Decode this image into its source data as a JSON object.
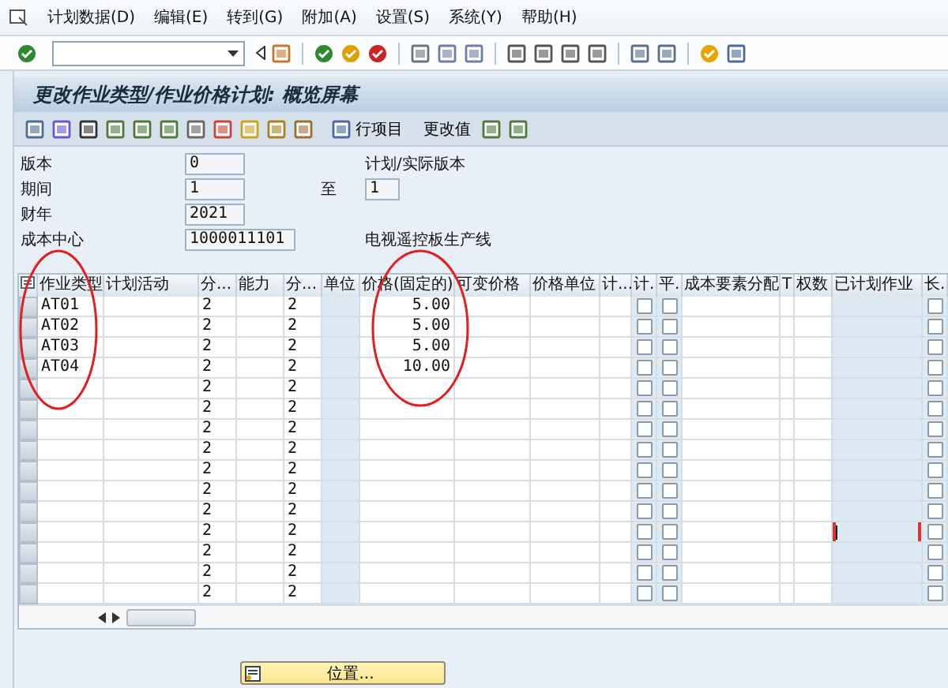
{
  "menu": [
    "计划数据(D)",
    "编辑(E)",
    "转到(G)",
    "附加(A)",
    "设置(S)",
    "系统(Y)",
    "帮助(H)"
  ],
  "window": {
    "title": "更改作业类型/作业价格计划: 概览屏幕"
  },
  "app_toolbar": {
    "line_items": "行项目",
    "change_values": "更改值"
  },
  "form": {
    "version_label": "版本",
    "version": "0",
    "version_text": "计划/实际版本",
    "period_label": "期间",
    "period_from": "1",
    "to_label": "至",
    "period_to": "1",
    "year_label": "财年",
    "year": "2021",
    "cost_center_label": "成本中心",
    "cost_center": "1000011101",
    "cost_center_text": "电视遥控板生产线"
  },
  "table": {
    "columns": [
      {
        "kind": "marker",
        "readonly": false
      },
      {
        "kind": "text",
        "label": "作业类型",
        "readonly": false
      },
      {
        "kind": "text",
        "label": "计划活动",
        "readonly": false
      },
      {
        "kind": "text",
        "label": "分...",
        "readonly": false
      },
      {
        "kind": "text",
        "label": "能力",
        "readonly": false
      },
      {
        "kind": "text",
        "label": "分...",
        "readonly": false
      },
      {
        "kind": "text",
        "label": "单位",
        "readonly": true
      },
      {
        "kind": "number",
        "label": "价格(固定的)",
        "readonly": false
      },
      {
        "kind": "text",
        "label": "可变价格",
        "readonly": false
      },
      {
        "kind": "text",
        "label": "价格单位",
        "readonly": false
      },
      {
        "kind": "text",
        "label": "计...",
        "readonly": false
      },
      {
        "kind": "check",
        "label": "计.",
        "readonly": true
      },
      {
        "kind": "check",
        "label": "平.",
        "readonly": true
      },
      {
        "kind": "text",
        "label": "成本要素分配",
        "readonly": false
      },
      {
        "kind": "text",
        "label": "T",
        "readonly": false
      },
      {
        "kind": "text",
        "label": "权数",
        "readonly": false
      },
      {
        "kind": "text",
        "label": "已计划作业",
        "readonly": true
      },
      {
        "kind": "check",
        "label": "长.",
        "readonly": true
      }
    ],
    "rows": [
      {
        "activity_type": "AT01",
        "dist_1": "2",
        "dist_2": "2",
        "price_fixed": "5.00",
        "plan_checked": false,
        "avg_checked": false,
        "long_checked": false,
        "focused": false
      },
      {
        "activity_type": "AT02",
        "dist_1": "2",
        "dist_2": "2",
        "price_fixed": "5.00",
        "plan_checked": false,
        "avg_checked": false,
        "long_checked": false,
        "focused": false
      },
      {
        "activity_type": "AT03",
        "dist_1": "2",
        "dist_2": "2",
        "price_fixed": "5.00",
        "plan_checked": false,
        "avg_checked": false,
        "long_checked": false,
        "focused": false
      },
      {
        "activity_type": "AT04",
        "dist_1": "2",
        "dist_2": "2",
        "price_fixed": "10.00",
        "plan_checked": false,
        "avg_checked": false,
        "long_checked": false,
        "focused": false
      },
      {
        "dist_1": "2",
        "dist_2": "2",
        "plan_checked": false,
        "avg_checked": false,
        "long_checked": false,
        "focused": false
      },
      {
        "dist_1": "2",
        "dist_2": "2",
        "plan_checked": false,
        "avg_checked": false,
        "long_checked": false,
        "focused": false
      },
      {
        "dist_1": "2",
        "dist_2": "2",
        "plan_checked": false,
        "avg_checked": false,
        "long_checked": false,
        "focused": false
      },
      {
        "dist_1": "2",
        "dist_2": "2",
        "plan_checked": false,
        "avg_checked": false,
        "long_checked": false,
        "focused": false
      },
      {
        "dist_1": "2",
        "dist_2": "2",
        "plan_checked": false,
        "avg_checked": false,
        "long_checked": false,
        "focused": false
      },
      {
        "dist_1": "2",
        "dist_2": "2",
        "plan_checked": false,
        "avg_checked": false,
        "long_checked": false,
        "focused": false
      },
      {
        "dist_1": "2",
        "dist_2": "2",
        "plan_checked": false,
        "avg_checked": false,
        "long_checked": false,
        "focused": false
      },
      {
        "dist_1": "2",
        "dist_2": "2",
        "plan_checked": false,
        "avg_checked": false,
        "long_checked": false,
        "focused": true
      },
      {
        "dist_1": "2",
        "dist_2": "2",
        "plan_checked": false,
        "avg_checked": false,
        "long_checked": false,
        "focused": false
      },
      {
        "dist_1": "2",
        "dist_2": "2",
        "plan_checked": false,
        "avg_checked": false,
        "long_checked": false,
        "focused": false
      },
      {
        "dist_1": "2",
        "dist_2": "2",
        "plan_checked": false,
        "avg_checked": false,
        "long_checked": false,
        "focused": false
      }
    ]
  },
  "position_button": "位置..."
}
